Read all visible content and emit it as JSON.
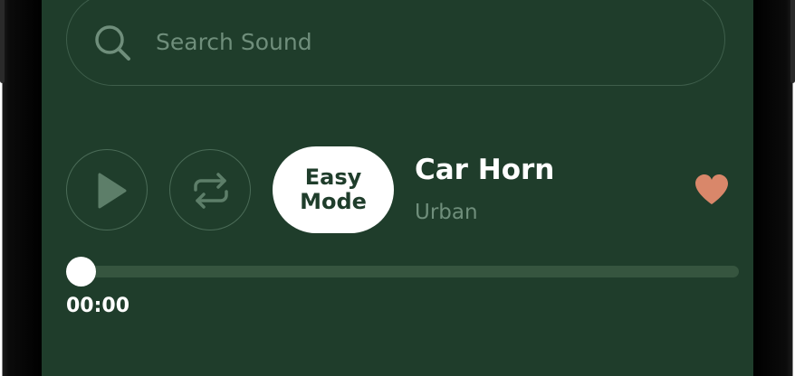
{
  "search": {
    "placeholder": "Search Sound",
    "value": ""
  },
  "controls": {
    "play_icon": "play-icon",
    "repeat_icon": "repeat-icon",
    "easy_mode_line1": "Easy",
    "easy_mode_line2": "Mode"
  },
  "track": {
    "title": "Car Horn",
    "category": "Urban",
    "favorite": true
  },
  "playback": {
    "current_time": "00:00",
    "progress": 0
  },
  "colors": {
    "background": "#1f3d2b",
    "heart": "#d9876a",
    "muted_text": "#6f8e7b"
  }
}
